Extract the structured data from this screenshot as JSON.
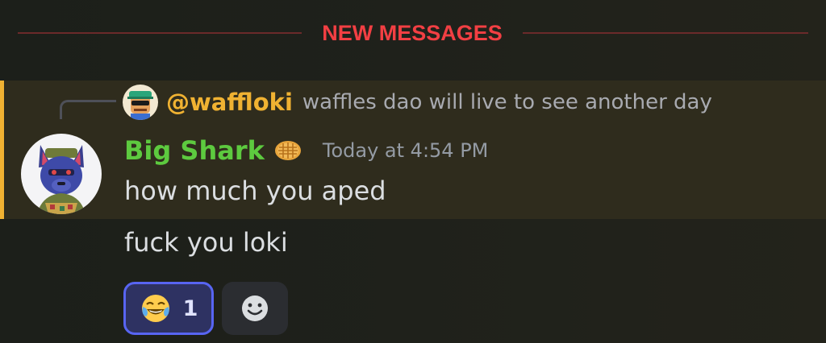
{
  "divider": {
    "label": "NEW MESSAGES"
  },
  "reply": {
    "author": "@waffloki",
    "text": "waffles dao will live to see another day"
  },
  "message": {
    "author": "Big Shark",
    "badge_icon": "waffle-icon",
    "timestamp": "Today at 4:54 PM",
    "lines": [
      "how much you aped",
      "fuck you loki"
    ]
  },
  "reactions": [
    {
      "emoji_icon": "joy-emoji-icon",
      "count": "1",
      "active": true
    },
    {
      "emoji_icon": "add-reaction-icon",
      "count": "",
      "active": false
    }
  ],
  "colors": {
    "background": "#1f211b",
    "highlight_bg": "#2f2c1d",
    "highlight_bar": "#f0b232",
    "divider_text": "#f23f43",
    "divider_line": "#6b2a2a",
    "username": "#5dca3f",
    "mention": "#f0b232",
    "timestamp": "#949ba4",
    "reaction_active_border": "#5865f2"
  }
}
